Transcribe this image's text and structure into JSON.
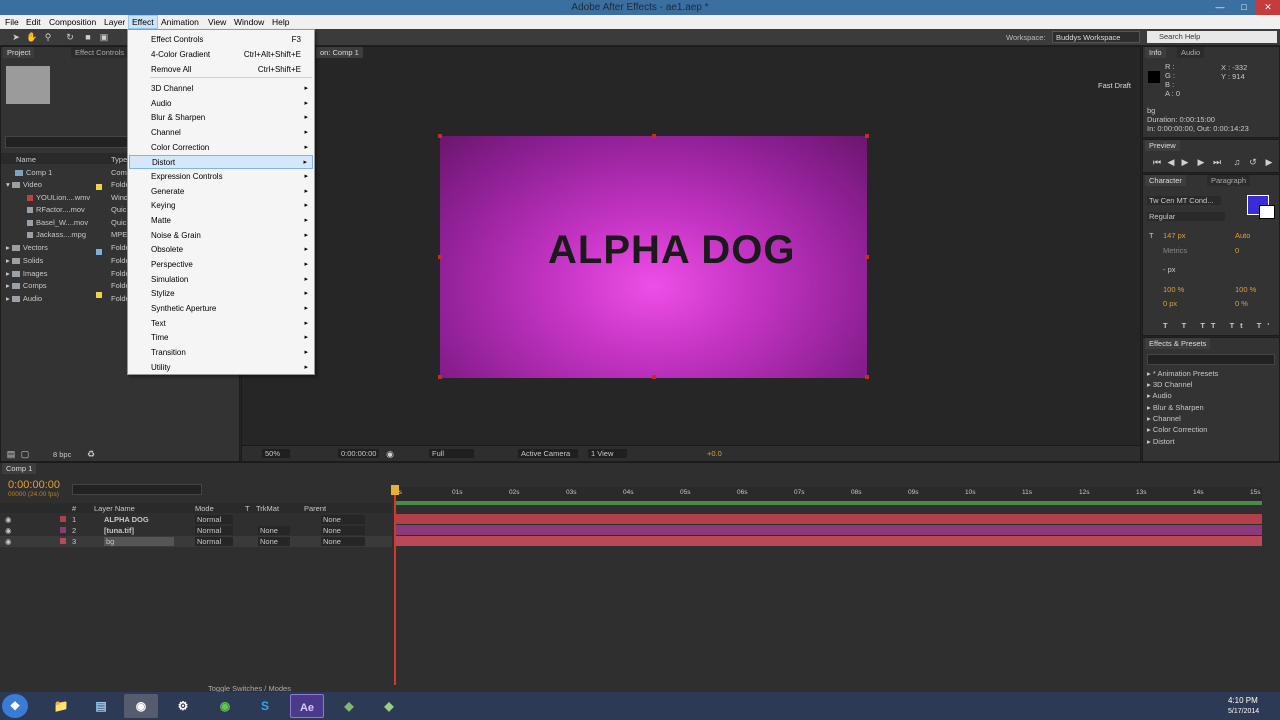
{
  "window": {
    "title": "Adobe After Effects - ae1.aep *"
  },
  "menubar": {
    "items": [
      "File",
      "Edit",
      "Composition",
      "Layer",
      "Effect",
      "Animation",
      "View",
      "Window",
      "Help"
    ],
    "active": "Effect"
  },
  "toolbar": {
    "workspace_label": "Workspace:",
    "workspace_value": "Buddys Workspace",
    "search_placeholder": "Search Help"
  },
  "effect_menu": {
    "items": [
      {
        "label": "Effect Controls",
        "shortcut": "F3"
      },
      {
        "label": "4-Color Gradient",
        "shortcut": "Ctrl+Alt+Shift+E"
      },
      {
        "label": "Remove All",
        "shortcut": "Ctrl+Shift+E"
      },
      {
        "label": "3D Channel"
      },
      {
        "label": "Audio"
      },
      {
        "label": "Blur & Sharpen"
      },
      {
        "label": "Channel"
      },
      {
        "label": "Color Correction"
      },
      {
        "label": "Distort"
      },
      {
        "label": "Expression Controls"
      },
      {
        "label": "Generate"
      },
      {
        "label": "Keying"
      },
      {
        "label": "Matte"
      },
      {
        "label": "Noise & Grain"
      },
      {
        "label": "Obsolete"
      },
      {
        "label": "Perspective"
      },
      {
        "label": "Simulation"
      },
      {
        "label": "Stylize"
      },
      {
        "label": "Synthetic Aperture"
      },
      {
        "label": "Text"
      },
      {
        "label": "Time"
      },
      {
        "label": "Transition"
      },
      {
        "label": "Utility"
      }
    ],
    "highlighted": "Distort"
  },
  "project_panel": {
    "tabs": [
      "Project",
      "Effect Controls"
    ],
    "columns": [
      "Name",
      "Type"
    ],
    "rows": [
      {
        "name": "Comp 1",
        "type": "Com"
      },
      {
        "name": "Video",
        "type": "Folde"
      },
      {
        "name": "YOULion....wmv",
        "type": "Wind"
      },
      {
        "name": "RFactor....mov",
        "type": "Quic"
      },
      {
        "name": "Basel_W....mov",
        "type": "Quic"
      },
      {
        "name": "Jackass....mpg",
        "type": "MPEG"
      },
      {
        "name": "Vectors",
        "type": "Folde"
      },
      {
        "name": "Solids",
        "type": "Folde"
      },
      {
        "name": "Images",
        "type": "Folde"
      },
      {
        "name": "Comps",
        "type": "Folde"
      },
      {
        "name": "Audio",
        "type": "Folde"
      }
    ],
    "bpc": "8 bpc"
  },
  "comp_viewer": {
    "tab": "on: Comp 1",
    "fast_draft": "Fast Draft",
    "title_text": "ALPHA DOG",
    "zoom": "50%",
    "timecode": "0:00:00:00",
    "resolution": "Full",
    "camera": "Active Camera",
    "views": "1 View",
    "exposure": "+0.0"
  },
  "info_panel": {
    "tabs": [
      "Info",
      "Audio"
    ],
    "rgba": "R :\nG :\nB :\nA : 0",
    "xy": "X : -332\nY : 914",
    "layer_name": "bg",
    "duration": "Duration: 0:00:15:00",
    "in_out": "In: 0:00:00:00, Out: 0:00:14:23"
  },
  "preview_panel": {
    "tab": "Preview"
  },
  "character_panel": {
    "tabs": [
      "Character",
      "Paragraph"
    ],
    "font": "Tw Cen MT Cond...",
    "style": "Regular",
    "size": "147 px",
    "leading": "Auto",
    "kerning": "Metrics",
    "tracking": "0",
    "stroke": "- px",
    "vscale": "100 %",
    "hscale": "100 %",
    "baseline": "0 px",
    "tsume": "0 %",
    "color_fill": "#3a2dd8"
  },
  "effects_panel": {
    "tab": "Effects & Presets",
    "items": [
      "* Animation Presets",
      "3D Channel",
      "Audio",
      "Blur & Sharpen",
      "Channel",
      "Color Correction",
      "Distort"
    ]
  },
  "timeline": {
    "tab": "Comp 1",
    "timecode": "0:00:00:00",
    "fps": "00000 (24.00 fps)",
    "col_headers": {
      "num": "#",
      "layer": "Layer Name",
      "mode": "Mode",
      "t": "T",
      "trkmat": "TrkMat",
      "parent": "Parent"
    },
    "layers": [
      {
        "num": "1",
        "name": "ALPHA DOG",
        "mode": "Normal",
        "trkmat": "",
        "parent": "None",
        "bar_color": "#b2404a"
      },
      {
        "num": "2",
        "name": "[tuna.tif]",
        "mode": "Normal",
        "trkmat": "None",
        "parent": "None",
        "bar_color": "#8a3a78"
      },
      {
        "num": "3",
        "name": "bg",
        "mode": "Normal",
        "trkmat": "None",
        "parent": "None",
        "bar_color": "#b84a56"
      }
    ],
    "ruler": [
      "0s",
      "01s",
      "02s",
      "03s",
      "04s",
      "05s",
      "06s",
      "07s",
      "08s",
      "09s",
      "10s",
      "11s",
      "12s",
      "13s",
      "14s",
      "15s"
    ],
    "toggle": "Toggle Switches / Modes"
  },
  "taskbar": {
    "time": "4:10 PM",
    "date": "5/17/2014",
    "apps": [
      "start-icon",
      "explorer-icon",
      "notepad-icon",
      "chrome-icon",
      "steam-icon",
      "spotify-icon",
      "skype-icon",
      "after-effects-icon",
      "app-icon",
      "app2-icon"
    ],
    "ae_label": "Ae"
  }
}
